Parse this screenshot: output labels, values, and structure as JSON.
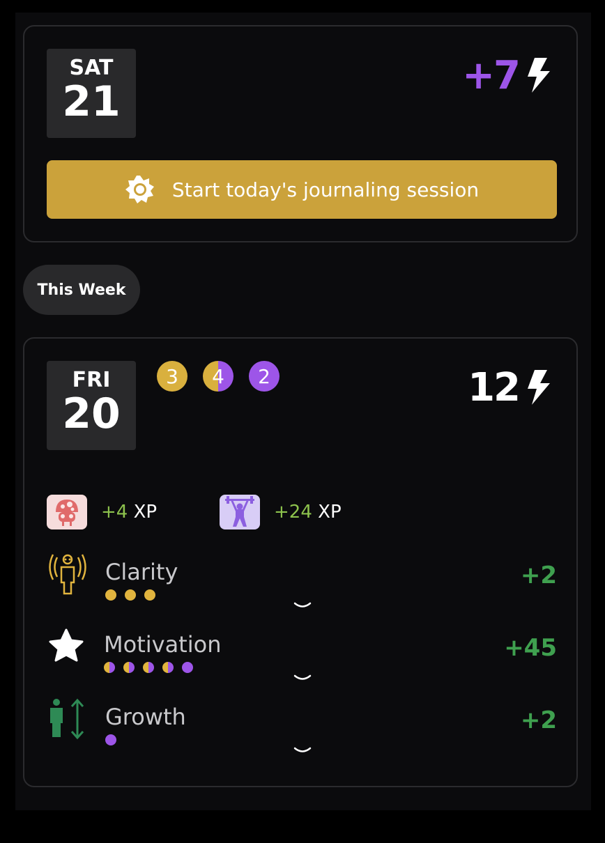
{
  "today": {
    "day_of_week": "SAT",
    "day_number": "21",
    "score": "+7",
    "start_button_label": "Start today's journaling session"
  },
  "week_pill_label": "This Week",
  "friday": {
    "day_of_week": "FRI",
    "day_number": "20",
    "badges": [
      "3",
      "4",
      "2"
    ],
    "score": "12",
    "xp": [
      {
        "amount": "+4",
        "unit": "XP",
        "icon": "brain-mushroom-icon"
      },
      {
        "amount": "+24",
        "unit": "XP",
        "icon": "weightlifter-icon"
      }
    ],
    "stats": [
      {
        "name": "Clarity",
        "delta": "+2",
        "icon": "clarity-person-icon",
        "dots": [
          "gold",
          "gold",
          "gold"
        ]
      },
      {
        "name": "Motivation",
        "delta": "+45",
        "icon": "star-icon",
        "dots": [
          "half",
          "half",
          "half",
          "half",
          "purple"
        ]
      },
      {
        "name": "Growth",
        "delta": "+2",
        "icon": "growth-person-icon",
        "dots": [
          "purple"
        ]
      }
    ]
  },
  "colors": {
    "accent_purple": "#9d55e8",
    "accent_gold": "#cba23b",
    "positive_green": "#3fa04f",
    "xp_green": "#8dc24d",
    "card_bg": "#0b0b0d"
  }
}
